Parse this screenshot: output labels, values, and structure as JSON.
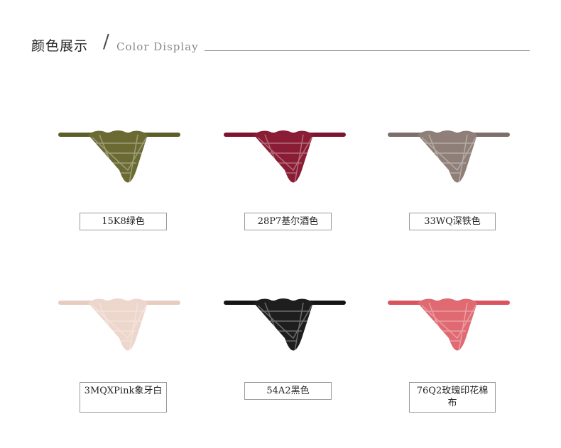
{
  "header": {
    "title_cn": "颜色展示",
    "divider": "/",
    "title_en": "Color Display"
  },
  "swatches": [
    {
      "label": "15K8绿色",
      "color": "#6b6a33",
      "band": "#5e5d2a"
    },
    {
      "label": "28P7基尔酒色",
      "color": "#8a1d35",
      "band": "#7d1530"
    },
    {
      "label": "33WQ深铁色",
      "color": "#8f7f78",
      "band": "#7c6e68"
    },
    {
      "label": "3MQXPink象牙白",
      "color": "#edd6cb",
      "band": "#e6cdbf"
    },
    {
      "label": "54A2黑色",
      "color": "#1e1e1e",
      "band": "#151515"
    },
    {
      "label": "76Q2玫瑰印花棉布",
      "color": "#e06a72",
      "band": "#d9545e"
    }
  ]
}
